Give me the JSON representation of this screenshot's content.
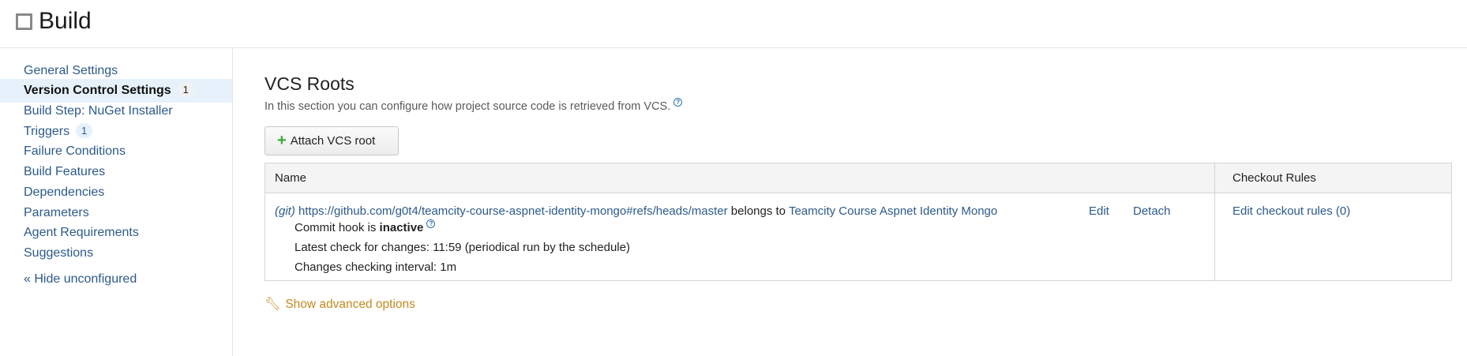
{
  "header": {
    "title": "Build"
  },
  "sidebar": {
    "items": [
      {
        "label": "General Settings"
      },
      {
        "label": "Version Control Settings",
        "badge": "1"
      },
      {
        "label": "Build Step: NuGet Installer"
      },
      {
        "label": "Triggers",
        "badge": "1"
      },
      {
        "label": "Failure Conditions"
      },
      {
        "label": "Build Features"
      },
      {
        "label": "Dependencies"
      },
      {
        "label": "Parameters"
      },
      {
        "label": "Agent Requirements"
      },
      {
        "label": "Suggestions"
      }
    ],
    "hide_unconfigured": "« Hide unconfigured"
  },
  "main": {
    "title": "VCS Roots",
    "description": "In this section you can configure how project source code is retrieved from VCS.",
    "help_glyph": "?",
    "attach_button": "Attach VCS root",
    "table": {
      "headers": {
        "name": "Name",
        "checkout_rules": "Checkout Rules"
      },
      "row": {
        "type_tag": "(git)",
        "url": "https://github.com/g0t4/teamcity-course-aspnet-identity-mongo#refs/heads/master",
        "belongs_to": "belongs to",
        "project": "Teamcity Course Aspnet Identity Mongo",
        "edit": "Edit",
        "detach": "Detach",
        "commit_hook_prefix": "Commit hook is",
        "commit_hook_status": "inactive",
        "latest_check": "Latest check for changes: 11:59 (periodical run by the schedule)",
        "interval": "Changes checking interval: 1m",
        "checkout_rules": "Edit checkout rules (0)"
      }
    },
    "advanced_options": "Show advanced options"
  },
  "colors": {
    "link": "#2c5a8a",
    "accent_orange": "#c48a1e",
    "active_bg": "#e6f1fb",
    "plus_green": "#3aa83a"
  },
  "icons": [
    "square-logo-icon",
    "help-icon",
    "plus-icon",
    "wrench-icon"
  ]
}
